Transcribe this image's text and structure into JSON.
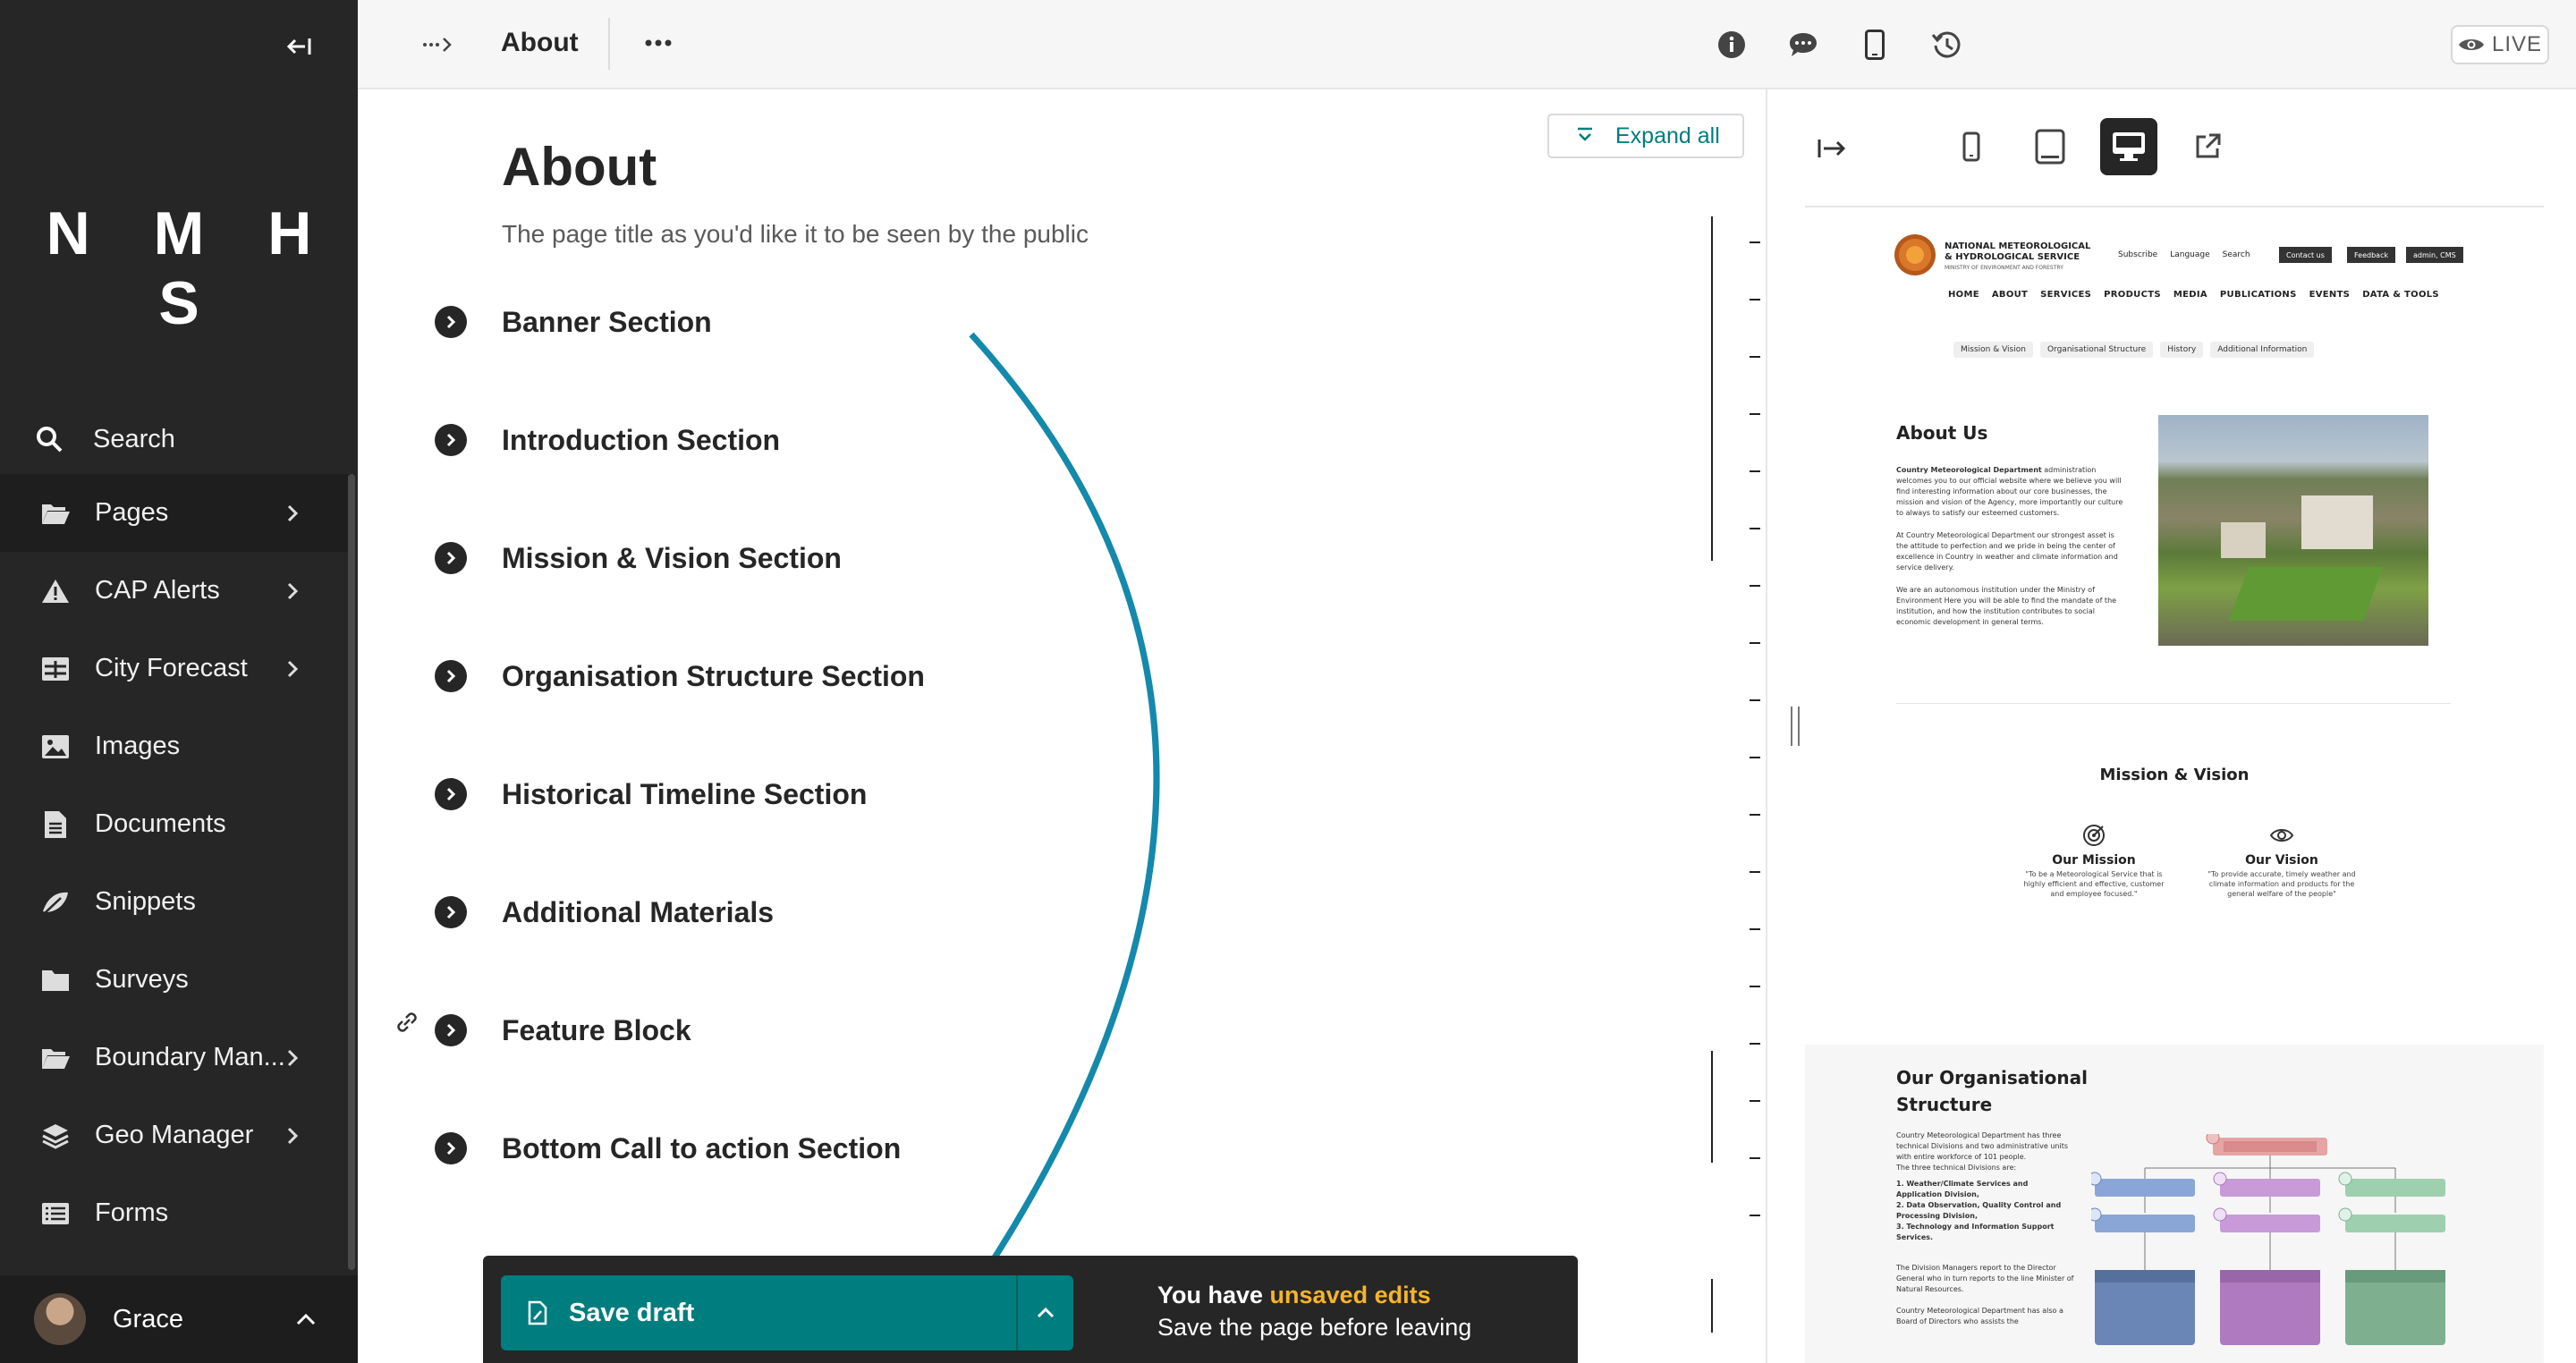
{
  "sidebar": {
    "logo": "N M H S",
    "search_label": "Search",
    "items": [
      {
        "label": "Pages",
        "icon": "folder-open-icon",
        "has_children": true,
        "active": true
      },
      {
        "label": "CAP Alerts",
        "icon": "warning-icon",
        "has_children": true
      },
      {
        "label": "City Forecast",
        "icon": "table-icon",
        "has_children": true
      },
      {
        "label": "Images",
        "icon": "image-icon",
        "has_children": false
      },
      {
        "label": "Documents",
        "icon": "document-icon",
        "has_children": false
      },
      {
        "label": "Snippets",
        "icon": "snippet-icon",
        "has_children": false
      },
      {
        "label": "Surveys",
        "icon": "folder-icon",
        "has_children": false
      },
      {
        "label": "Boundary Man...",
        "icon": "folder-open-icon",
        "has_children": true
      },
      {
        "label": "Geo Manager",
        "icon": "layers-icon",
        "has_children": true
      },
      {
        "label": "Forms",
        "icon": "list-icon",
        "has_children": false
      }
    ],
    "account_name": "Grace"
  },
  "header": {
    "page_name": "About",
    "live_label": "LIVE"
  },
  "editor": {
    "expand_all_label": "Expand all",
    "title": "About",
    "help_text": "The page title as you'd like it to be seen by the public",
    "sections": [
      "Banner Section",
      "Introduction Section",
      "Mission & Vision Section",
      "Organisation Structure Section",
      "Historical Timeline Section",
      "Additional Materials",
      "Feature Block",
      "Bottom Call to action Section"
    ]
  },
  "savebar": {
    "save_label": "Save draft",
    "msg_prefix": "You have ",
    "msg_highlight": "unsaved edits",
    "msg_line2": "Save the page before leaving"
  },
  "preview": {
    "org_name_1": "NATIONAL METEOROLOGICAL",
    "org_name_2": "& HYDROLOGICAL SERVICE",
    "org_sub": "MINISTRY OF ENVIRONMENT AND FORESTRY",
    "util": [
      "Subscribe",
      "Language",
      "Search"
    ],
    "buttons": [
      "Contact us",
      "Feedback",
      "admin, CMS"
    ],
    "nav": [
      "HOME",
      "ABOUT",
      "SERVICES",
      "PRODUCTS",
      "MEDIA",
      "PUBLICATIONS",
      "EVENTS",
      "DATA & TOOLS"
    ],
    "chips": [
      "Mission & Vision",
      "Organisational Structure",
      "History",
      "Additional Information"
    ],
    "about_title": "About Us",
    "about_p1_bold": "Country Meteorological Department",
    "about_p1": " administration welcomes you to our official website where we believe you will find interesting information about our core businesses, the mission and vision of the Agency, more importantly our culture to always to satisfy our esteemed customers.",
    "about_p2": "At Country Meteorological Department our strongest asset is the attitude to perfection and we pride in being the center of excellence in Country in weather and climate information and service delivery.",
    "about_p3": "We are an autonomous institution under the Ministry of Environment Here you will be able to find the mandate of the institution, and how the institution contributes to social economic development in general terms.",
    "mv_title": "Mission & Vision",
    "mission_title": "Our Mission",
    "mission_text": "\"To be a Meteorological Service that is highly efficient and effective, customer and employee focused.\"",
    "vision_title": "Our Vision",
    "vision_text": "\"To provide accurate, timely weather and climate information and products for the general welfare of the people\"",
    "org_title_1": "Our Organisational",
    "org_title_2": "Structure",
    "org_p1": "Country Meteorological Department has three technical Divisions and two administrative units with entire workforce of 101 people.",
    "org_p2": "The three technical Divisions are:",
    "org_list": [
      "Weather/Climate Services and Application Division,",
      "Data Observation, Quality Control and Processing Division,",
      "Technology and Information Support Services."
    ],
    "org_p3": "The Division Managers report to the Director General who in turn reports to the line Minister of Natural Resources.",
    "org_p4": "Country Meteorological Department has also a Board of Directors who assists the"
  }
}
